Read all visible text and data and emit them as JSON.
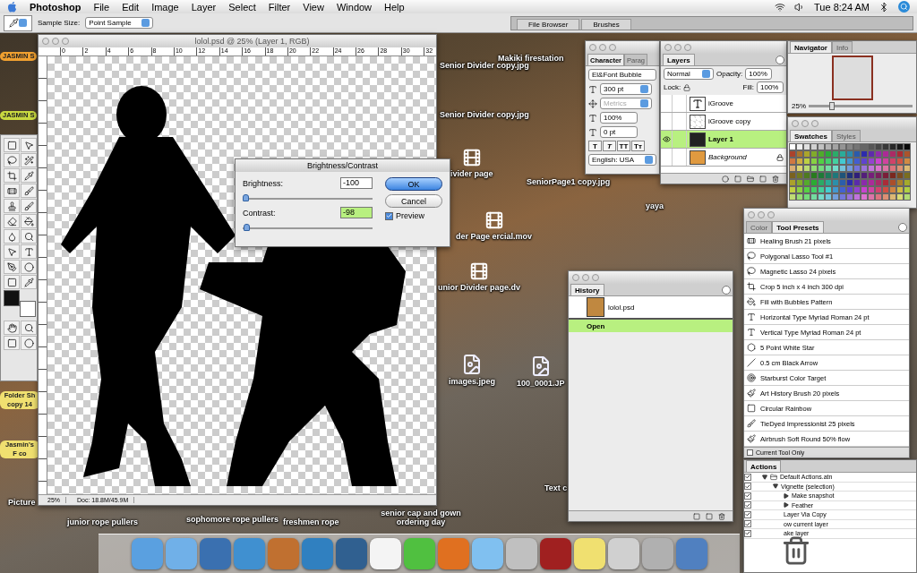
{
  "menubar": {
    "app": "Photoshop",
    "menus": [
      "File",
      "Edit",
      "Image",
      "Layer",
      "Select",
      "Filter",
      "View",
      "Window",
      "Help"
    ],
    "clock": "Tue 8:24 AM"
  },
  "options_bar": {
    "sample_size_label": "Sample Size:",
    "sample_size": "Point Sample"
  },
  "palette_well": {
    "tabs": [
      "File Browser",
      "Brushes"
    ]
  },
  "desktop_icons": [
    {
      "label": "JASMIN S",
      "kind": "label",
      "color": "#f0a030"
    },
    {
      "label": "JASMIN S",
      "kind": "label",
      "color": "#c8d840"
    },
    {
      "label": "Folder Sh copy 14",
      "kind": "label",
      "color": "#f0e070"
    },
    {
      "label": "Jasmin's F co",
      "kind": "label",
      "color": "#f0e070"
    },
    {
      "label": "Picture",
      "kind": "label"
    },
    {
      "label": "Senior Divider copy.jpg",
      "kind": "label"
    },
    {
      "label": "Makiki firestation",
      "kind": "label"
    },
    {
      "label": "Senior Divider copy.jpg",
      "kind": "label"
    },
    {
      "label": "ivider page",
      "kind": "movie"
    },
    {
      "label": "SeniorPage1 copy.jpg",
      "kind": "label"
    },
    {
      "label": "yaya",
      "kind": "label"
    },
    {
      "label": "der Page ercial.mov",
      "kind": "movie"
    },
    {
      "label": "unior Divider page.dv",
      "kind": "movie"
    },
    {
      "label": "images.jpeg",
      "kind": "file"
    },
    {
      "label": "100_0001.JP",
      "kind": "file"
    },
    {
      "label": "Text c",
      "kind": "label"
    },
    {
      "label": "junior rope pullers",
      "kind": "label"
    },
    {
      "label": "sophomore rope pullers",
      "kind": "label"
    },
    {
      "label": "freshmen rope",
      "kind": "label"
    },
    {
      "label": "senior cap and gown ordering day",
      "kind": "label"
    }
  ],
  "document": {
    "title": "lolol.psd @ 25% (Layer 1, RGB)",
    "ruler_marks": [
      "0",
      "2",
      "4",
      "6",
      "8",
      "10",
      "12",
      "14",
      "16",
      "18",
      "20",
      "22",
      "24",
      "26",
      "28",
      "30",
      "32"
    ],
    "zoom": "25%",
    "doc_size": "Doc: 18.8M/45.9M"
  },
  "dialog": {
    "title": "Brightness/Contrast",
    "fields": [
      {
        "label": "Brightness:",
        "value": "-100",
        "level": 0.0,
        "highlighted": false
      },
      {
        "label": "Contrast:",
        "value": "-98",
        "level": 0.01,
        "highlighted": true
      }
    ],
    "ok": "OK",
    "cancel": "Cancel",
    "preview": {
      "label": "Preview",
      "checked": true
    }
  },
  "character": {
    "tabs": [
      {
        "label": "Character",
        "selected": true
      },
      {
        "label": "Parag",
        "selected": false
      }
    ],
    "font": "El&Font Bubble",
    "size": "300 pt",
    "kerning": "Metrics",
    "scale": "100%",
    "shift": "0 pt",
    "style_buttons": [
      "T",
      "T",
      "TT",
      "Tт"
    ],
    "language": "English: USA"
  },
  "layers": {
    "tab": "Layers",
    "blend": "Normal",
    "opacity_label": "Opacity:",
    "opacity": "100%",
    "lock_label": "Lock:",
    "fill_label": "Fill:",
    "fill": "100%",
    "rows": [
      {
        "name": "iGroove",
        "kind": "text",
        "visible": false,
        "selected": false,
        "locked": false
      },
      {
        "name": "iGroove copy",
        "kind": "empty",
        "visible": false,
        "selected": false,
        "locked": false
      },
      {
        "name": "Layer 1",
        "kind": "image",
        "visible": true,
        "selected": true,
        "locked": false
      },
      {
        "name": "Background",
        "kind": "fill",
        "visible": false,
        "selected": false,
        "locked": true
      }
    ]
  },
  "navigator": {
    "tabs": [
      {
        "label": "Navigator",
        "selected": true
      },
      {
        "label": "Info",
        "selected": false
      }
    ],
    "zoom": "25%",
    "level": 0.2
  },
  "swatches": {
    "tabs": [
      {
        "label": "Swatches",
        "selected": true
      },
      {
        "label": "Styles",
        "selected": false
      }
    ]
  },
  "tool_presets": {
    "tabs": [
      {
        "label": "Color",
        "selected": false
      },
      {
        "label": "Tool Presets",
        "selected": true
      }
    ],
    "items": [
      "Healing Brush 21 pixels",
      "Polygonal Lasso Tool #1",
      "Magnetic Lasso 24 pixels",
      "Crop 5 inch x 4 inch 300 dpi",
      "Fill with Bubbles Pattern",
      "Horizontal Type Myriad Roman 24 pt",
      "Vertical Type Myriad Roman 24 pt",
      "5 Point White Star",
      "0.5 cm Black Arrow",
      "Starburst Color Target",
      "Art History Brush 20 pixels",
      "Circular Rainbow",
      "TieDyed Impressionist 25 pixels",
      "Airbrush Soft Round 50% flow"
    ],
    "current_tool_only": {
      "label": "Current Tool Only",
      "checked": false
    }
  },
  "history": {
    "tab": "History",
    "snapshot": "lolol.psd",
    "steps": [
      {
        "label": "Open",
        "selected": true
      }
    ]
  },
  "actions": {
    "tab": "Actions",
    "items": [
      {
        "label": "Default Actions.atn",
        "checked": true,
        "expanded": true,
        "children": [
          {
            "label": "Vignette (selection)",
            "checked": true,
            "expanded": true,
            "children": [
              {
                "label": "Make snapshot",
                "checked": true,
                "expanded": false
              },
              {
                "label": "Feather",
                "checked": true,
                "expanded": false
              },
              {
                "label": "Layer Via Copy",
                "checked": true
              },
              {
                "label": "ow current layer",
                "checked": true
              },
              {
                "label": "ake layer",
                "checked": true
              }
            ]
          }
        ]
      }
    ]
  }
}
